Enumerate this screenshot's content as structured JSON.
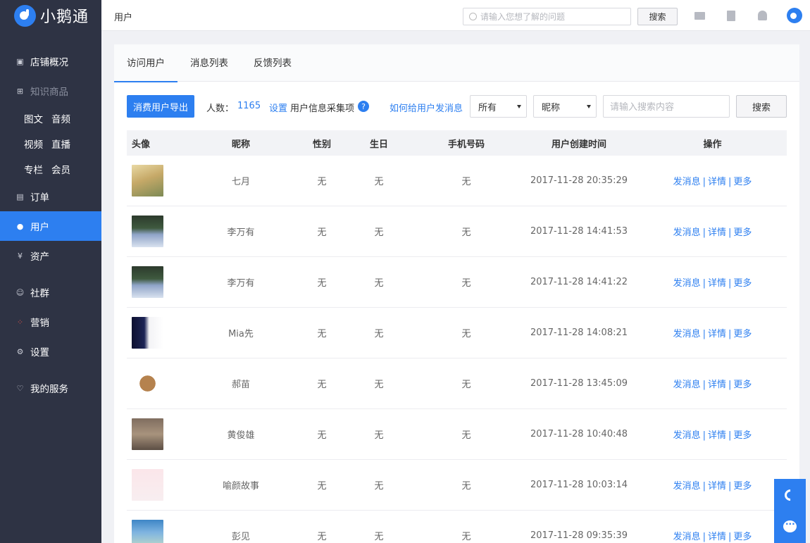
{
  "app": {
    "logo_text": "小鹅通"
  },
  "sidebar": {
    "items": [
      {
        "label": "店铺概况",
        "icon": "dashboard-icon"
      },
      {
        "label": "知识商品",
        "icon": "grid-icon",
        "disabled": true
      },
      {
        "label": "订单",
        "icon": "order-icon"
      },
      {
        "label": "用户",
        "icon": "user-icon",
        "active": true
      },
      {
        "label": "资产",
        "icon": "yen-icon"
      },
      {
        "label": "社群",
        "icon": "community-icon"
      },
      {
        "label": "营销",
        "icon": "marketing-icon"
      },
      {
        "label": "设置",
        "icon": "gear-icon"
      },
      {
        "label": "我的服务",
        "icon": "heart-icon"
      }
    ],
    "sub": {
      "tuwen": "图文",
      "yinpin": "音频",
      "shipin": "视频",
      "zhibo": "直播",
      "zhuanlan": "专栏",
      "huiyuan": "会员"
    }
  },
  "header": {
    "title": "用户",
    "search_placeholder": "请输入您想了解的问题",
    "search_button": "搜索"
  },
  "tabs": [
    "访问用户",
    "消息列表",
    "反馈列表"
  ],
  "toolbar": {
    "export_button": "消费用户导出",
    "count_label": "人数：",
    "count_value": "1165",
    "settings_link": "设置",
    "settings_text": "用户信息采集项",
    "help_icon": "?",
    "how_link": "如何给用户发消息",
    "filter_select": "所有",
    "field_select": "昵称",
    "keyword_placeholder": "请输入搜索内容",
    "search_button": "搜索"
  },
  "table": {
    "columns": [
      "头像",
      "昵称",
      "性别",
      "生日",
      "手机号码",
      "用户创建时间",
      "操作"
    ],
    "ops": {
      "send": "发消息",
      "detail": "详情",
      "more": "更多",
      "sep": "|"
    },
    "rows": [
      {
        "name": "七月",
        "gender": "无",
        "birthday": "无",
        "phone": "无",
        "created": "2017-11-28 20:35:29"
      },
      {
        "name": "李万有",
        "gender": "无",
        "birthday": "无",
        "phone": "无",
        "created": "2017-11-28 14:41:53"
      },
      {
        "name": "李万有",
        "gender": "无",
        "birthday": "无",
        "phone": "无",
        "created": "2017-11-28 14:41:22"
      },
      {
        "name": "Mia先",
        "gender": "无",
        "birthday": "无",
        "phone": "无",
        "created": "2017-11-28 14:08:21"
      },
      {
        "name": "郝苗",
        "gender": "无",
        "birthday": "无",
        "phone": "无",
        "created": "2017-11-28 13:45:09"
      },
      {
        "name": "黄俊雄",
        "gender": "无",
        "birthday": "无",
        "phone": "无",
        "created": "2017-11-28 10:40:48"
      },
      {
        "name": "喻颜故事",
        "gender": "无",
        "birthday": "无",
        "phone": "无",
        "created": "2017-11-28 10:03:14"
      },
      {
        "name": "彭见",
        "gender": "无",
        "birthday": "无",
        "phone": "无",
        "created": "2017-11-28 09:35:39"
      }
    ]
  },
  "colors": {
    "accent": "#2d7ff0",
    "sidebar": "#2e3344"
  }
}
